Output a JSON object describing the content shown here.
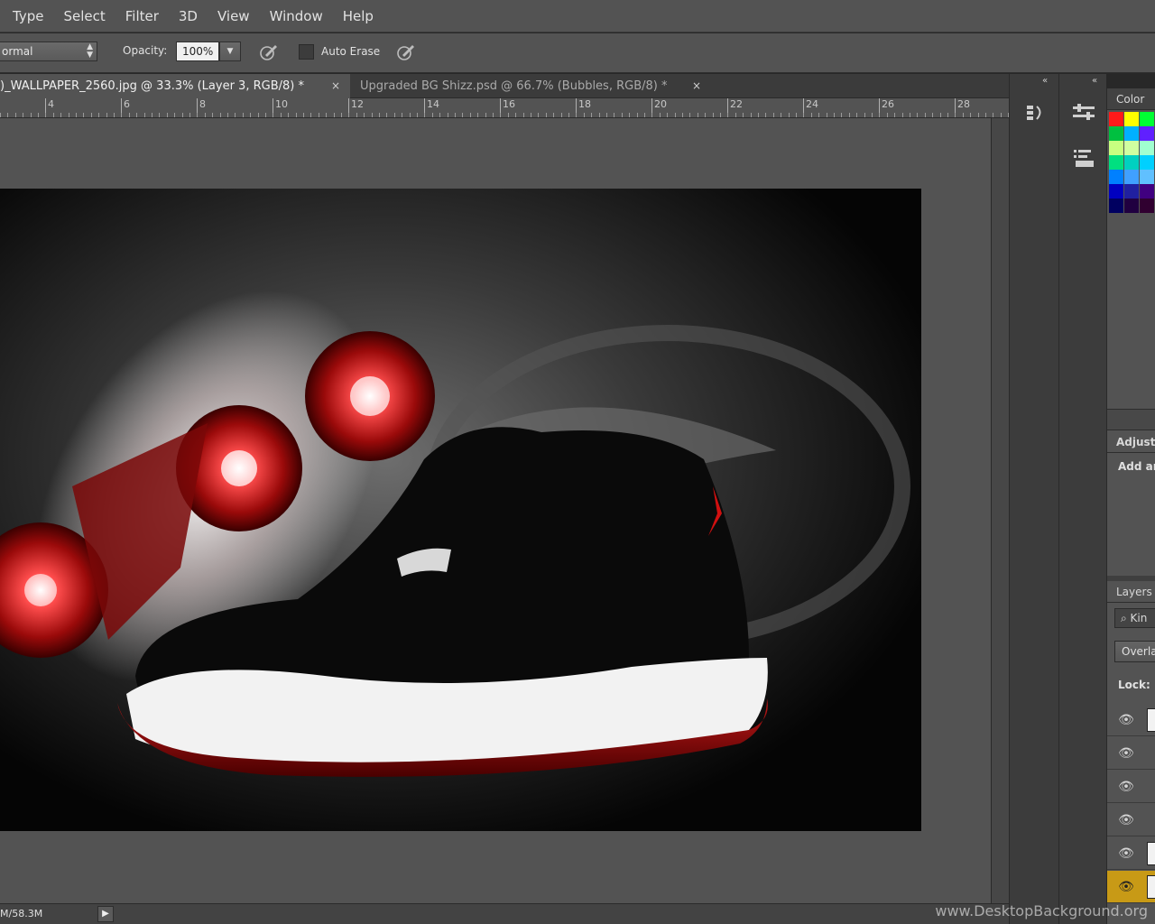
{
  "menu": [
    "Type",
    "Select",
    "Filter",
    "3D",
    "View",
    "Window",
    "Help"
  ],
  "options": {
    "blend_mode": "ormal",
    "opacity_label": "Opacity:",
    "opacity_value": "100%",
    "auto_erase_label": "Auto Erase"
  },
  "tabs": [
    {
      "label": ")_WALLPAPER_2560.jpg @ 33.3% (Layer 3, RGB/8) *",
      "close": "×"
    },
    {
      "label": "Upgraded BG Shizz.psd @ 66.7% (Bubbles, RGB/8) *",
      "close": "×"
    }
  ],
  "ruler": [
    "4",
    "6",
    "8",
    "10",
    "12",
    "14",
    "16",
    "18",
    "20",
    "22",
    "24",
    "26",
    "28"
  ],
  "status": {
    "doc_size": "M/58.3M",
    "arrow": "▶"
  },
  "panels": {
    "collapse": "«",
    "color_title": "Color",
    "adjustments_title": "Adjustm",
    "adjustments_subtitle": "Add ar",
    "layers_title": "Layers",
    "layers_search": "Kin",
    "layers_blend": "Overla",
    "lock_label": "Lock:"
  },
  "swatch_colors": [
    "#ff1a1a",
    "#ffff00",
    "#00ff33",
    "#ffffff",
    "#00c040",
    "#00b0ff",
    "#6020ff",
    "#ff40ff",
    "#c8ff80",
    "#d0ffa0",
    "#a0ffd0",
    "#e0ffe0",
    "#00e080",
    "#00d0c0",
    "#00d0ff",
    "#80ffff",
    "#0080ff",
    "#40a0ff",
    "#60c0ff",
    "#a0d8ff",
    "#0000c0",
    "#2020a0",
    "#400080",
    "#600060",
    "#000060",
    "#200040",
    "#300030",
    "#400020"
  ],
  "watermark": "www.DesktopBackground.org"
}
